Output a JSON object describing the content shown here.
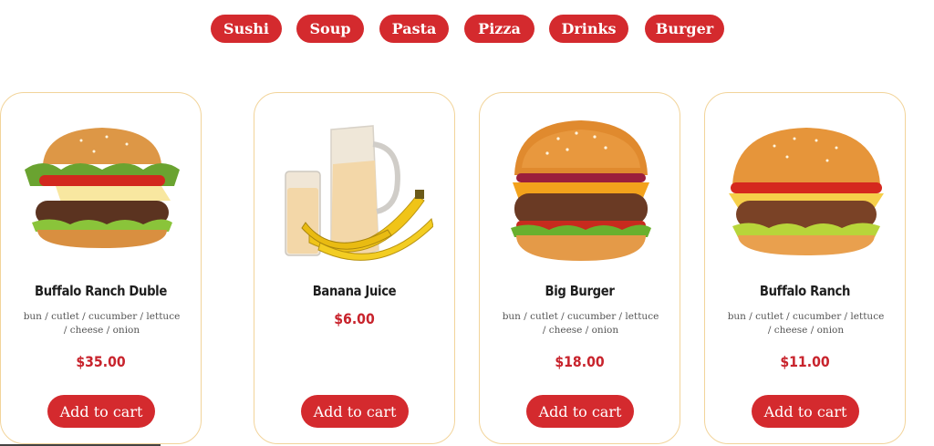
{
  "categories": [
    "Sushi",
    "Soup",
    "Pasta",
    "Pizza",
    "Drinks",
    "Burger"
  ],
  "products": [
    {
      "name": "Banana Juice",
      "description": "",
      "price": "$6.00",
      "button": "Add to cart",
      "image": "banana-juice-image"
    },
    {
      "name": "Big Burger",
      "description": "bun / cutlet / cucumber / lettuce / cheese / onion",
      "price": "$18.00",
      "button": "Add to cart",
      "image": "big-burger-image"
    },
    {
      "name": "Buffalo Ranch",
      "description": "bun / cutlet / cucumber / lettuce / cheese / onion",
      "price": "$11.00",
      "button": "Add to cart",
      "image": "buffalo-ranch-image"
    },
    {
      "name": "Buffalo Ranch Duble",
      "description": "bun / cutlet / cucumber / lettuce / cheese / onion",
      "price": "$35.00",
      "button": "Add to cart",
      "image": "buffalo-ranch-duble-image"
    }
  ],
  "colors": {
    "accent": "#d42a2e",
    "price": "#c8232c",
    "card_border": "#f2d49a"
  }
}
